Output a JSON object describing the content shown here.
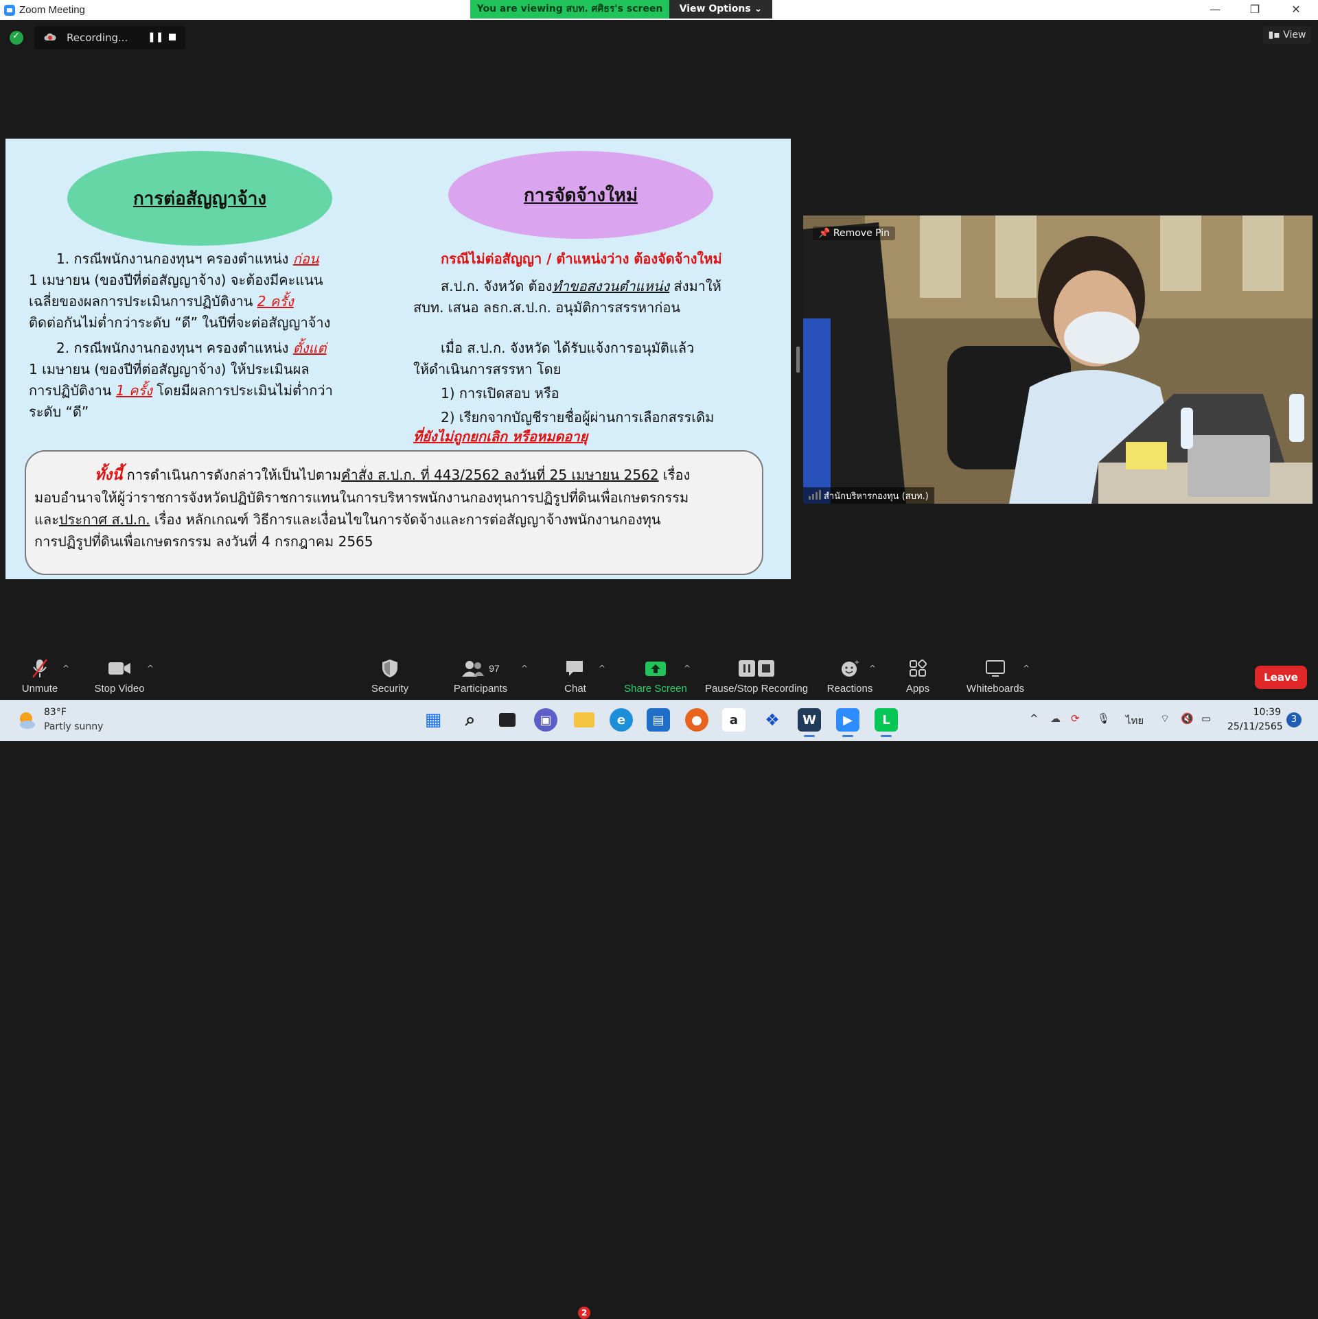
{
  "window": {
    "title": "Zoom Meeting",
    "viewing_banner": "You are viewing สบท. ศศิธร's screen",
    "view_options": "View Options ⌄"
  },
  "window_controls": {
    "minimize": "—",
    "restore": "❐",
    "close": "✕"
  },
  "recording": {
    "label": "Recording...",
    "pause_symbol": "❚❚"
  },
  "view_button": "View",
  "slide": {
    "left_heading": "การต่อสัญญาจ้าง",
    "right_heading": "การจัดจ้างใหม่",
    "left_p1": {
      "a": "1. กรณีพนักงานกองทุนฯ ครองตำแหน่ง ",
      "b": "ก่อน",
      "c": "1 เมษายน (ของปีที่ต่อสัญญาจ้าง) จะต้องมีคะแนน",
      "d": "เฉลี่ยของผลการประเมินการปฏิบัติงาน ",
      "e": "2 ครั้ง",
      "f": "ติดต่อกันไม่ต่ำกว่าระดับ “ดี” ในปีที่จะต่อสัญญาจ้าง"
    },
    "left_p2": {
      "a": "2. กรณีพนักงานกองทุนฯ ครองตำแหน่ง ",
      "b": "ตั้งแต่",
      "c": "1 เมษายน (ของปีที่ต่อสัญญาจ้าง) ให้ประเมินผล",
      "d": "การปฏิบัติงาน ",
      "e": "1 ครั้ง",
      "f": " โดยมีผลการประเมินไม่ต่ำกว่า",
      "g": "ระดับ “ดี”"
    },
    "right_sub": "กรณีไม่ต่อสัญญา / ตำแหน่งว่าง ต้องจัดจ้างใหม่",
    "right_p1": {
      "a": "ส.ป.ก. จังหวัด ต้อง",
      "b": "ทำขอสงวนตำแหน่ง",
      "c": " ส่งมาให้",
      "d": "สบท. เสนอ ลธก.ส.ป.ก. อนุมัติการสรรหาก่อน"
    },
    "right_p2": {
      "a": "เมื่อ ส.ป.ก. จังหวัด ได้รับแจ้งการอนุมัติแล้ว",
      "b": "ให้ดำเนินการสรรหา โดย",
      "c": "1) การเปิดสอบ หรือ",
      "d": "2) เรียกจากบัญชีรายชื่อผู้ผ่านการเลือกสรรเดิม",
      "e": "ที่ยังไม่ถูกยกเลิก หรือหมดอายุ"
    },
    "note": {
      "lead": "ทั้งนี้",
      "a": " การดำเนินการดังกล่าวให้เป็นไปตาม",
      "b": "คำสั่ง ส.ป.ก. ที่ 443/2562 ลงวันที่ 25 เมษายน 2562",
      "c": " เรื่อง",
      "d": "มอบอำนาจให้ผู้ว่าราชการจังหวัดปฏิบัติราชการแทนในการบริหารพนักงานกองทุนการปฏิรูปที่ดินเพื่อเกษตรกรรม",
      "e": "และ",
      "f": "ประกาศ ส.ป.ก.",
      "g": " เรื่อง หลักเกณฑ์ วิธีการและเงื่อนไขในการจัดจ้างและการต่อสัญญาจ้างพนักงานกองทุน",
      "h": "การปฏิรูปที่ดินเพื่อเกษตรกรรม ลงวันที่ 4 กรกฎาคม 2565"
    }
  },
  "video": {
    "remove_pin": "Remove Pin",
    "participant_name": "สำนักบริหารกองทุน (สบท.)"
  },
  "toolbar": {
    "unmute": "Unmute",
    "stop_video": "Stop Video",
    "security": "Security",
    "participants": "Participants",
    "participants_count": "97",
    "chat": "Chat",
    "chat_badge": "2",
    "share_screen": "Share Screen",
    "pause_stop_recording": "Pause/Stop Recording",
    "reactions": "Reactions",
    "apps": "Apps",
    "whiteboards": "Whiteboards",
    "leave": "Leave",
    "caret": "^"
  },
  "taskbar": {
    "temperature": "83°F",
    "condition": "Partly sunny",
    "language": "ไทย",
    "time": "10:39",
    "date": "25/11/2565",
    "notifications": "3",
    "tray_chevron": "^"
  },
  "colors": {
    "slide_bg": "#d6eefa",
    "left_oval": "#66d6a7",
    "right_oval": "#dba4ee",
    "emphasis_red": "#dd1111",
    "share_green": "#21c45a",
    "leave_red": "#e02828"
  }
}
